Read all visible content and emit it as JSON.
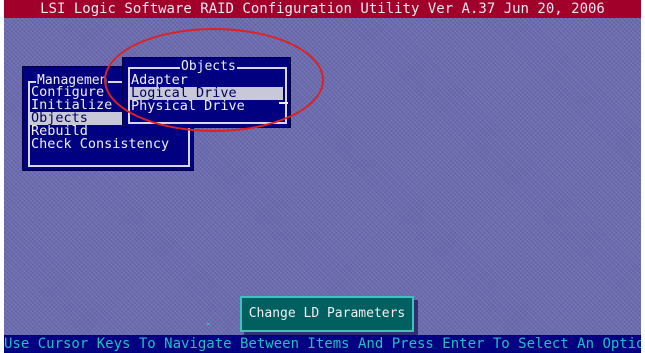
{
  "title_bar": "LSI Logic Software RAID Configuration Utility Ver A.37 Jun 20, 2006",
  "management_menu": {
    "title": "Managemen",
    "items": [
      {
        "label": "Configure",
        "selected": false
      },
      {
        "label": "Initialize",
        "selected": false
      },
      {
        "label": "Objects",
        "selected": true
      },
      {
        "label": "Rebuild",
        "selected": false
      },
      {
        "label": "Check Consistency",
        "selected": false
      }
    ]
  },
  "objects_menu": {
    "title": "Objects",
    "items": [
      {
        "label": "Adapter",
        "selected": false
      },
      {
        "label": "Logical Drive",
        "selected": true
      },
      {
        "label": "Physical Drive",
        "selected": false
      }
    ]
  },
  "help_box": "Change LD Parameters",
  "status_bar": "Use Cursor Keys To Navigate Between Items And Press Enter To Select An Option",
  "colors": {
    "background": "#6a6ab0",
    "title_bar": "#a0002a",
    "menu": "#000080",
    "highlight": "#c8c8d8",
    "status_text": "#20c0c0",
    "help_box": "#006060",
    "annotation_oval": "#e02020"
  }
}
